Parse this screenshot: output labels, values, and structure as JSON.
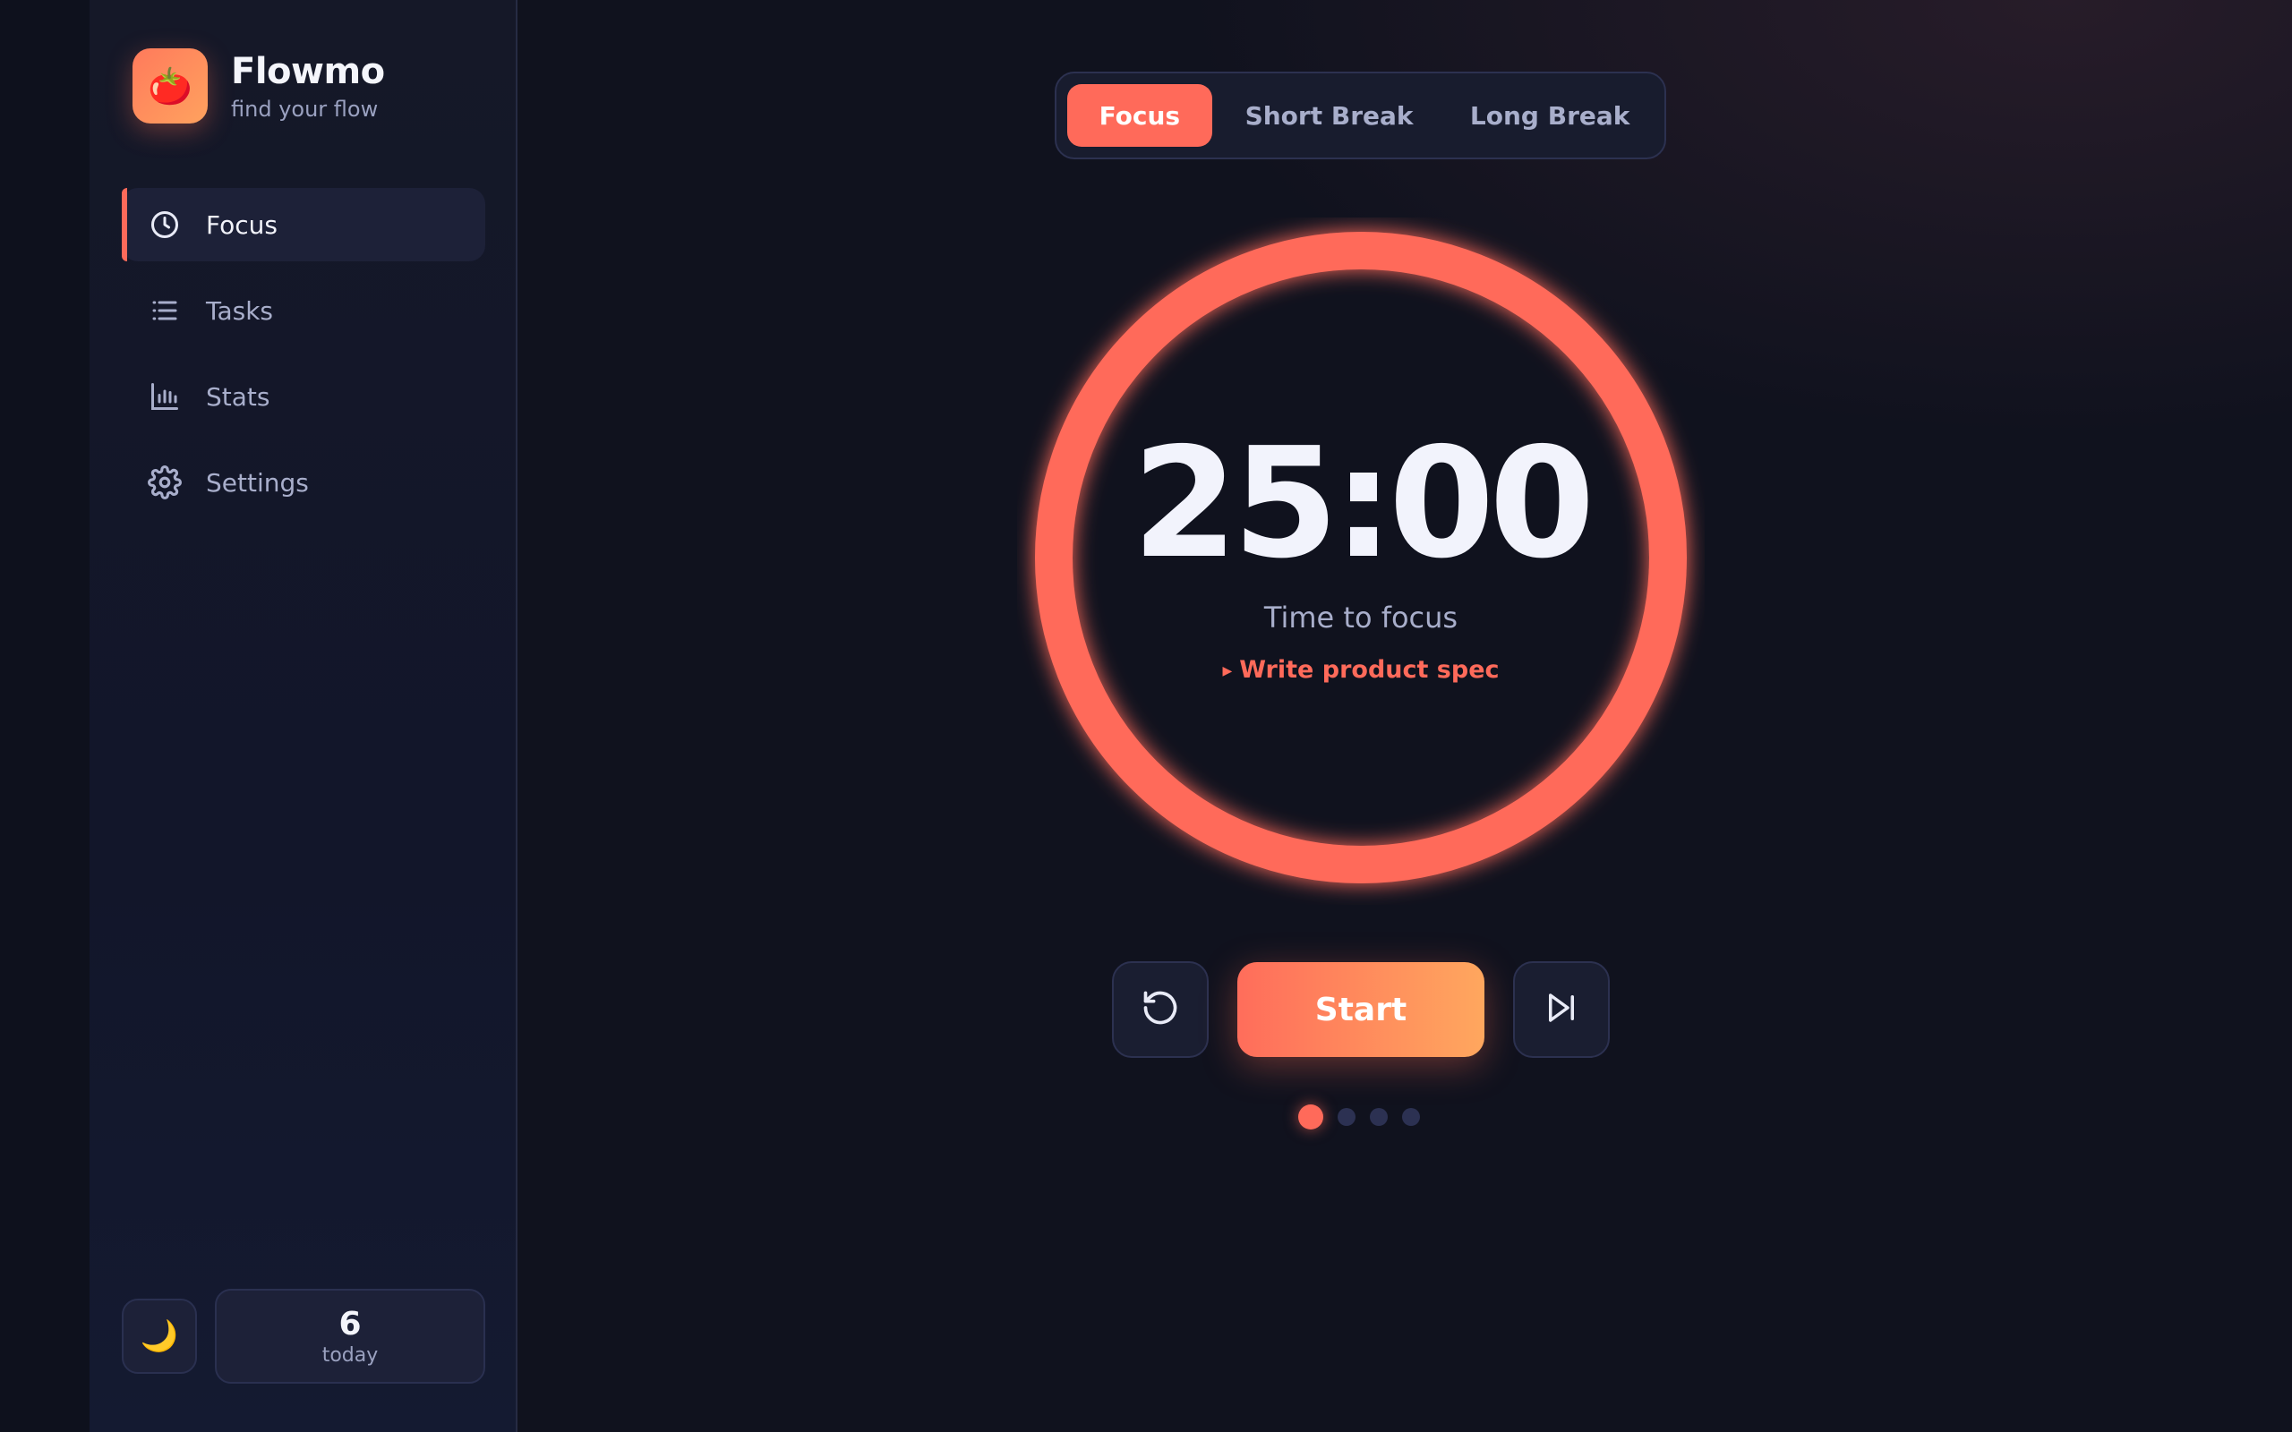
{
  "app": {
    "name": "Flowmo",
    "tagline": "find your flow",
    "logo_icon": "tomato-icon",
    "logo_glyph": "🍅"
  },
  "sidebar": {
    "items": [
      {
        "label": "Focus",
        "icon": "clock-icon",
        "active": true
      },
      {
        "label": "Tasks",
        "icon": "list-icon",
        "active": false
      },
      {
        "label": "Stats",
        "icon": "bar-chart-icon",
        "active": false
      },
      {
        "label": "Settings",
        "icon": "gear-icon",
        "active": false
      }
    ],
    "footer": {
      "theme_icon": "moon-icon",
      "theme_glyph": "🌙",
      "today_count": "6",
      "today_label": "today"
    }
  },
  "modes": {
    "tabs": [
      {
        "label": "Focus",
        "active": true
      },
      {
        "label": "Short Break",
        "active": false
      },
      {
        "label": "Long Break",
        "active": false
      }
    ]
  },
  "timer": {
    "time": "25:00",
    "label": "Time to focus",
    "task": "Write product spec",
    "progress": 1.0
  },
  "controls": {
    "reset_icon": "reset-icon",
    "start_label": "Start",
    "skip_icon": "skip-forward-icon"
  },
  "sessions": {
    "total": 4,
    "current": 1
  },
  "colors": {
    "accent": "#ff6a5a",
    "accent_gradient_end": "#ffa75e",
    "background": "#10121e",
    "sidebar": "#151828",
    "text_muted": "#a8aecb"
  }
}
